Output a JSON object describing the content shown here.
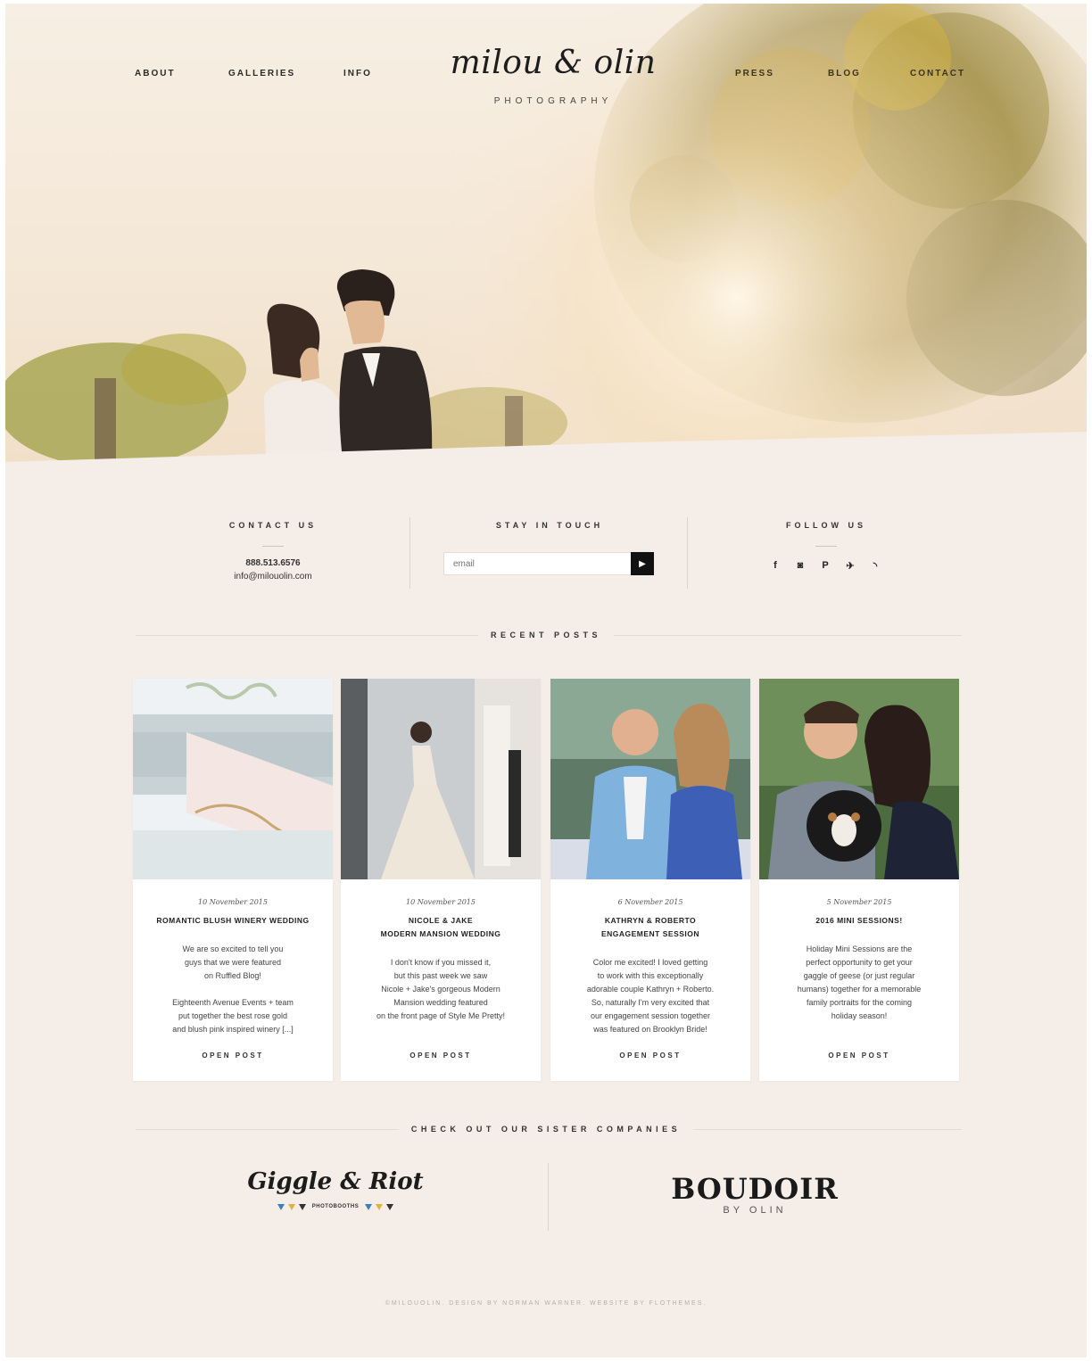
{
  "nav": {
    "about": "ABOUT",
    "galleries": "GALLERIES",
    "info": "INFO",
    "press": "PRESS",
    "blog": "BLOG",
    "contact": "CONTACT"
  },
  "logo": {
    "script": "milou & olin",
    "sub": "PHOTOGRAPHY"
  },
  "contact": {
    "title": "CONTACT US",
    "phone": "888.513.6576",
    "email": "info@milouolin.com"
  },
  "newsletter": {
    "title": "STAY IN TOUCH",
    "placeholder": "email",
    "submit_icon": "arrow-right-icon"
  },
  "follow": {
    "title": "FOLLOW US",
    "icons": [
      "facebook-icon",
      "instagram-icon",
      "pinterest-icon",
      "twitter-icon",
      "rss-icon"
    ],
    "glyphs": [
      "f",
      "◙",
      "P",
      "✈",
      "◝"
    ]
  },
  "recent": {
    "title": "RECENT POSTS",
    "open_label": "OPEN POST",
    "posts": [
      {
        "date": "10 November 2015",
        "title": "ROMANTIC BLUSH WINERY WEDDING",
        "excerpt": "We are so excited to tell you\nguys that we were featured\non Ruffled Blog!\n\nEighteenth Avenue Events + team\nput together the best rose gold\nand blush pink inspired winery [...]"
      },
      {
        "date": "10 November 2015",
        "title": "NICOLE & JAKE\nMODERN MANSION WEDDING",
        "excerpt": "I don't know if you missed it,\nbut this past week we saw\nNicole + Jake's gorgeous Modern\nMansion wedding featured\non the front page of Style Me Pretty!"
      },
      {
        "date": "6 November 2015",
        "title": "KATHRYN & ROBERTO\nENGAGEMENT SESSION",
        "excerpt": "Color me excited! I loved getting\nto work with this exceptionally\nadorable couple Kathryn + Roberto.\nSo, naturally I'm very excited that\nour engagement session together\nwas featured on Brooklyn Bride!"
      },
      {
        "date": "5 November 2015",
        "title": "2016 MINI SESSIONS!",
        "excerpt": "Holiday Mini Sessions are the\nperfect opportunity to get your\ngaggle of geese (or just regular\nhumans) together for a memorable\nfamily portraits for the coming\nholiday season!"
      }
    ]
  },
  "sister": {
    "title": "CHECK OUT OUR SISTER COMPANIES",
    "giggle": "Giggle & Riot",
    "giggle_sub": "PHOTOBOOTHS",
    "boudoir": "BOUDOIR",
    "boudoir_sub": "BY OLIN"
  },
  "footer": {
    "text": "©MILOUOLIN. DESIGN BY NORMAN WARNER. WEBSITE BY FLOTHEMES."
  },
  "colors": {
    "page_bg": "#f5ede7",
    "card_bg": "#ffffff",
    "button_dark": "#111111"
  }
}
